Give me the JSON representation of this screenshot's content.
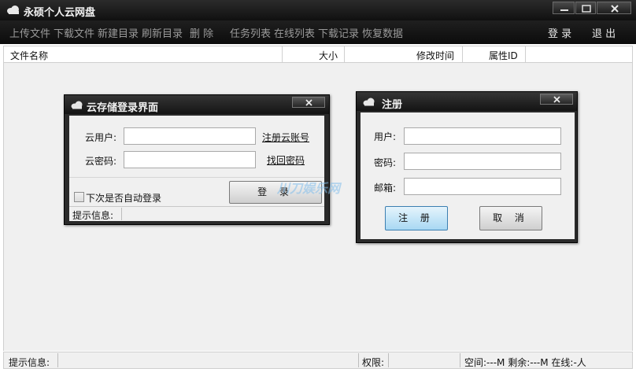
{
  "window": {
    "title": "永硕个人云网盘"
  },
  "menu": {
    "items": [
      "上传文件",
      "下载文件",
      "新建目录",
      "刷新目录",
      "删  除",
      "任务列表",
      "在线列表",
      "下载记录",
      "恢复数据"
    ],
    "login": "登 录",
    "logout": "退 出"
  },
  "file_table": {
    "columns": [
      "文件名称",
      "大小",
      "修改时间",
      "属性ID"
    ]
  },
  "status_bar": {
    "hint_label": "提示信息:",
    "permission_label": "权限:",
    "space_info": "空间:---M 剩余:---M 在线:-人"
  },
  "login_dialog": {
    "title": "云存储登录界面",
    "user_label": "云用户:",
    "user_value": "",
    "password_label": "云密码:",
    "password_value": "",
    "register_link": "注册云账号",
    "recover_link": "找回密码",
    "auto_login_label": "下次是否自动登录",
    "auto_login_checked": false,
    "login_button": "登 录",
    "hint_label": "提示信息:"
  },
  "register_dialog": {
    "title": "注册",
    "user_label": "用户:",
    "user_value": "",
    "password_label": "密码:",
    "password_value": "",
    "email_label": "邮箱:",
    "email_value": "",
    "register_button": "注 册",
    "cancel_button": "取 消"
  },
  "colors": {
    "titlebar": "#141414",
    "menu_text": "#9a9a9a",
    "workspace": "#f0f0f0",
    "primary_button": "#a8d8f3"
  }
}
